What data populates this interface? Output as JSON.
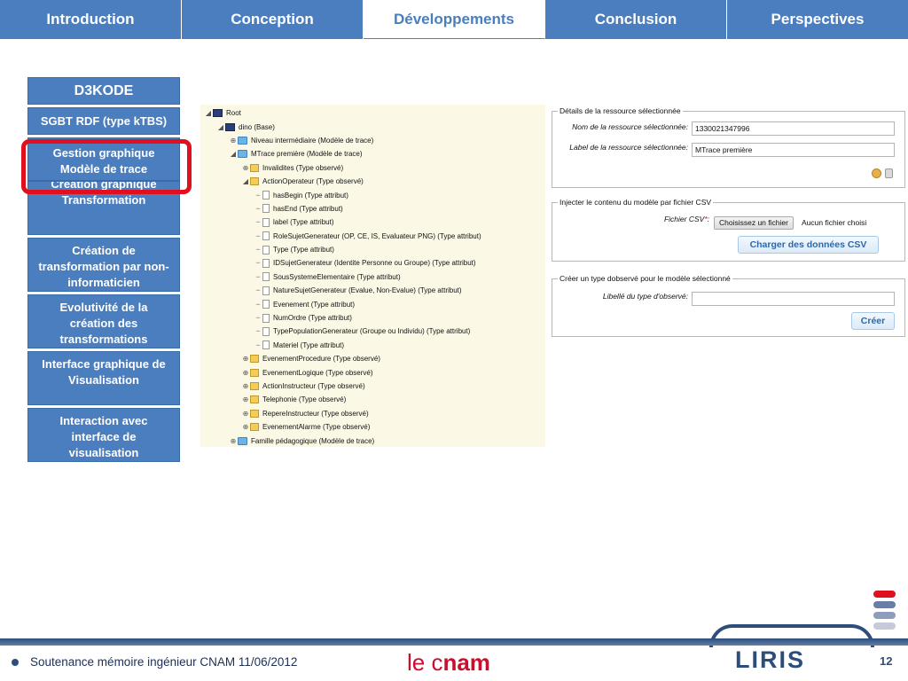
{
  "nav": {
    "tabs": [
      {
        "label": "Introduction"
      },
      {
        "label": "Conception"
      },
      {
        "label": "Développements"
      },
      {
        "label": "Conclusion"
      },
      {
        "label": "Perspectives"
      }
    ],
    "active": "Développements"
  },
  "sidebar": {
    "title": "D3KODE",
    "items": [
      {
        "label": "SGBT RDF (type kTBS)"
      },
      {
        "label": "Gestion graphique Modèle de trace"
      },
      {
        "label": "Création graphique Transformation"
      },
      {
        "label": "Création de transformation par non-informaticien"
      },
      {
        "label": "Evolutivité de la création des transformations"
      },
      {
        "label": "Interface graphique de Visualisation"
      },
      {
        "label": "Interaction avec interface de visualisation"
      }
    ]
  },
  "tree": {
    "nodes": [
      {
        "label": "Root",
        "icon": "root",
        "depth": 0
      },
      {
        "label": "dino (Base)",
        "icon": "base",
        "depth": 1
      },
      {
        "label": "Niveau intermédiaire (Modèle de trace)",
        "icon": "folder-blue",
        "depth": 2
      },
      {
        "label": "MTrace première (Modèle de trace)",
        "icon": "folder-blue",
        "depth": 2
      },
      {
        "label": "Invalidites (Type observé)",
        "icon": "folder-yellow",
        "depth": 3
      },
      {
        "label": "ActionOperateur (Type observé)",
        "icon": "folder-yellow",
        "depth": 3
      },
      {
        "label": "hasBegin (Type attribut)",
        "icon": "doc",
        "depth": 4
      },
      {
        "label": "hasEnd (Type attribut)",
        "icon": "doc",
        "depth": 4
      },
      {
        "label": "label (Type attribut)",
        "icon": "doc",
        "depth": 4
      },
      {
        "label": "RoleSujetGenerateur (OP, CE, IS, Evaluateur PNG) (Type attribut)",
        "icon": "doc",
        "depth": 4
      },
      {
        "label": "Type (Type attribut)",
        "icon": "doc",
        "depth": 4
      },
      {
        "label": "IDSujetGenerateur (Identite Personne ou Groupe) (Type attribut)",
        "icon": "doc",
        "depth": 4
      },
      {
        "label": "SousSystemeElementaire (Type attribut)",
        "icon": "doc",
        "depth": 4
      },
      {
        "label": "NatureSujetGenerateur (Evalue, Non-Evalue) (Type attribut)",
        "icon": "doc",
        "depth": 4
      },
      {
        "label": "Evenement (Type attribut)",
        "icon": "doc",
        "depth": 4
      },
      {
        "label": "NumOrdre (Type attribut)",
        "icon": "doc",
        "depth": 4
      },
      {
        "label": "TypePopulationGenerateur (Groupe ou Individu) (Type attribut)",
        "icon": "doc",
        "depth": 4
      },
      {
        "label": "Materiel (Type attribut)",
        "icon": "doc",
        "depth": 4
      },
      {
        "label": "EvenementProcedure (Type observé)",
        "icon": "folder-yellow",
        "depth": 3
      },
      {
        "label": "EvenementLogique (Type observé)",
        "icon": "folder-yellow",
        "depth": 3
      },
      {
        "label": "ActionInstructeur (Type observé)",
        "icon": "folder-yellow",
        "depth": 3
      },
      {
        "label": "Telephonie (Type observé)",
        "icon": "folder-yellow",
        "depth": 3
      },
      {
        "label": "RepereInstructeur (Type observé)",
        "icon": "folder-yellow",
        "depth": 3
      },
      {
        "label": "EvenementAlarme (Type observé)",
        "icon": "folder-yellow",
        "depth": 3
      },
      {
        "label": "Famille pédagogique (Modèle de trace)",
        "icon": "folder-blue",
        "depth": 2
      }
    ]
  },
  "details": {
    "legend": "Détails de la ressource sélectionnée",
    "name_label": "Nom de la ressource sélectionnée:",
    "name_value": "1330021347996",
    "label_label": "Label de la ressource sélectionnée:",
    "label_value": "MTrace première"
  },
  "csv": {
    "legend": "Injecter le contenu du modèle par fichier CSV",
    "file_label": "Fichier CSV",
    "required_mark": "*",
    "file_label_suffix": ":",
    "choose_button": "Choisissez un fichier",
    "no_file": "Aucun fichier choisi",
    "load_button": "Charger des données CSV"
  },
  "create": {
    "legend": "Créer un type dobservé pour le modèle sélectionné",
    "label": "Libellé du type d'observé:",
    "value": "",
    "button": "Créer"
  },
  "footer": {
    "text": "Soutenance mémoire ingénieur CNAM 11/06/2012",
    "logo_prefix": "le c",
    "logo_suffix": "nam",
    "liris": "LIRIS",
    "page": "12"
  },
  "colors": {
    "accent": "#4a7ebf",
    "highlight": "#e0101e",
    "footer": "#2d4e7a",
    "bars": [
      "#e0101e",
      "#6a7da6",
      "#8f9dbd",
      "#c6cbdc"
    ]
  }
}
